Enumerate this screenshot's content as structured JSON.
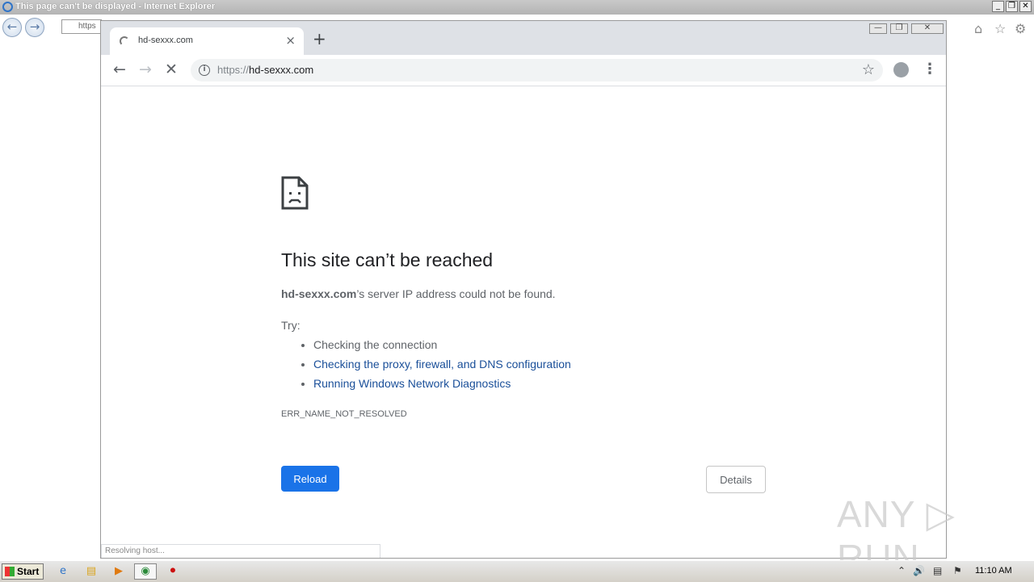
{
  "ie": {
    "title": "This page can't be displayed - Internet Explorer",
    "address_partial": "https",
    "controls": {
      "minimize": "_",
      "restore": "❐",
      "close": "✕"
    }
  },
  "chrome": {
    "tab": {
      "title": "hd-sexxx.com",
      "close": "×"
    },
    "new_tab": "+",
    "window_controls": {
      "minimize": "—",
      "restore": "❐",
      "close": "✕"
    },
    "url": {
      "scheme": "https://",
      "host": "hd-sexxx.com"
    }
  },
  "error_page": {
    "heading": "This site can’t be reached",
    "host": "hd-sexxx.com",
    "description_rest": "’s server IP address could not be found.",
    "try_label": "Try:",
    "suggestions": [
      {
        "text": "Checking the connection",
        "is_link": false
      },
      {
        "text": "Checking the proxy, firewall, and DNS configuration",
        "is_link": true
      },
      {
        "text": "Running Windows Network Diagnostics",
        "is_link": true
      }
    ],
    "error_code": "ERR_NAME_NOT_RESOLVED",
    "reload_label": "Reload",
    "details_label": "Details",
    "status": "Resolving host..."
  },
  "watermark": "ANY ▷ RUN",
  "taskbar": {
    "start_label": "Start",
    "clock": "11:10 AM"
  },
  "colors": {
    "accent": "#1a73e8",
    "link": "#1a4f99",
    "tabstrip": "#dee1e6"
  }
}
